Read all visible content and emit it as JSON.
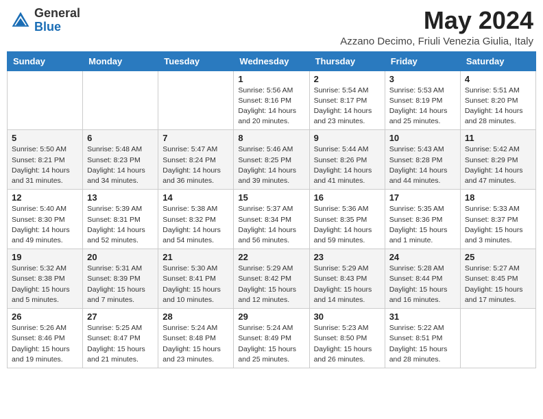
{
  "header": {
    "logo_general": "General",
    "logo_blue": "Blue",
    "month_title": "May 2024",
    "subtitle": "Azzano Decimo, Friuli Venezia Giulia, Italy"
  },
  "weekdays": [
    "Sunday",
    "Monday",
    "Tuesday",
    "Wednesday",
    "Thursday",
    "Friday",
    "Saturday"
  ],
  "weeks": [
    [
      {
        "day": "",
        "info": ""
      },
      {
        "day": "",
        "info": ""
      },
      {
        "day": "",
        "info": ""
      },
      {
        "day": "1",
        "info": "Sunrise: 5:56 AM\nSunset: 8:16 PM\nDaylight: 14 hours\nand 20 minutes."
      },
      {
        "day": "2",
        "info": "Sunrise: 5:54 AM\nSunset: 8:17 PM\nDaylight: 14 hours\nand 23 minutes."
      },
      {
        "day": "3",
        "info": "Sunrise: 5:53 AM\nSunset: 8:19 PM\nDaylight: 14 hours\nand 25 minutes."
      },
      {
        "day": "4",
        "info": "Sunrise: 5:51 AM\nSunset: 8:20 PM\nDaylight: 14 hours\nand 28 minutes."
      }
    ],
    [
      {
        "day": "5",
        "info": "Sunrise: 5:50 AM\nSunset: 8:21 PM\nDaylight: 14 hours\nand 31 minutes."
      },
      {
        "day": "6",
        "info": "Sunrise: 5:48 AM\nSunset: 8:23 PM\nDaylight: 14 hours\nand 34 minutes."
      },
      {
        "day": "7",
        "info": "Sunrise: 5:47 AM\nSunset: 8:24 PM\nDaylight: 14 hours\nand 36 minutes."
      },
      {
        "day": "8",
        "info": "Sunrise: 5:46 AM\nSunset: 8:25 PM\nDaylight: 14 hours\nand 39 minutes."
      },
      {
        "day": "9",
        "info": "Sunrise: 5:44 AM\nSunset: 8:26 PM\nDaylight: 14 hours\nand 41 minutes."
      },
      {
        "day": "10",
        "info": "Sunrise: 5:43 AM\nSunset: 8:28 PM\nDaylight: 14 hours\nand 44 minutes."
      },
      {
        "day": "11",
        "info": "Sunrise: 5:42 AM\nSunset: 8:29 PM\nDaylight: 14 hours\nand 47 minutes."
      }
    ],
    [
      {
        "day": "12",
        "info": "Sunrise: 5:40 AM\nSunset: 8:30 PM\nDaylight: 14 hours\nand 49 minutes."
      },
      {
        "day": "13",
        "info": "Sunrise: 5:39 AM\nSunset: 8:31 PM\nDaylight: 14 hours\nand 52 minutes."
      },
      {
        "day": "14",
        "info": "Sunrise: 5:38 AM\nSunset: 8:32 PM\nDaylight: 14 hours\nand 54 minutes."
      },
      {
        "day": "15",
        "info": "Sunrise: 5:37 AM\nSunset: 8:34 PM\nDaylight: 14 hours\nand 56 minutes."
      },
      {
        "day": "16",
        "info": "Sunrise: 5:36 AM\nSunset: 8:35 PM\nDaylight: 14 hours\nand 59 minutes."
      },
      {
        "day": "17",
        "info": "Sunrise: 5:35 AM\nSunset: 8:36 PM\nDaylight: 15 hours\nand 1 minute."
      },
      {
        "day": "18",
        "info": "Sunrise: 5:33 AM\nSunset: 8:37 PM\nDaylight: 15 hours\nand 3 minutes."
      }
    ],
    [
      {
        "day": "19",
        "info": "Sunrise: 5:32 AM\nSunset: 8:38 PM\nDaylight: 15 hours\nand 5 minutes."
      },
      {
        "day": "20",
        "info": "Sunrise: 5:31 AM\nSunset: 8:39 PM\nDaylight: 15 hours\nand 7 minutes."
      },
      {
        "day": "21",
        "info": "Sunrise: 5:30 AM\nSunset: 8:41 PM\nDaylight: 15 hours\nand 10 minutes."
      },
      {
        "day": "22",
        "info": "Sunrise: 5:29 AM\nSunset: 8:42 PM\nDaylight: 15 hours\nand 12 minutes."
      },
      {
        "day": "23",
        "info": "Sunrise: 5:29 AM\nSunset: 8:43 PM\nDaylight: 15 hours\nand 14 minutes."
      },
      {
        "day": "24",
        "info": "Sunrise: 5:28 AM\nSunset: 8:44 PM\nDaylight: 15 hours\nand 16 minutes."
      },
      {
        "day": "25",
        "info": "Sunrise: 5:27 AM\nSunset: 8:45 PM\nDaylight: 15 hours\nand 17 minutes."
      }
    ],
    [
      {
        "day": "26",
        "info": "Sunrise: 5:26 AM\nSunset: 8:46 PM\nDaylight: 15 hours\nand 19 minutes."
      },
      {
        "day": "27",
        "info": "Sunrise: 5:25 AM\nSunset: 8:47 PM\nDaylight: 15 hours\nand 21 minutes."
      },
      {
        "day": "28",
        "info": "Sunrise: 5:24 AM\nSunset: 8:48 PM\nDaylight: 15 hours\nand 23 minutes."
      },
      {
        "day": "29",
        "info": "Sunrise: 5:24 AM\nSunset: 8:49 PM\nDaylight: 15 hours\nand 25 minutes."
      },
      {
        "day": "30",
        "info": "Sunrise: 5:23 AM\nSunset: 8:50 PM\nDaylight: 15 hours\nand 26 minutes."
      },
      {
        "day": "31",
        "info": "Sunrise: 5:22 AM\nSunset: 8:51 PM\nDaylight: 15 hours\nand 28 minutes."
      },
      {
        "day": "",
        "info": ""
      }
    ]
  ]
}
